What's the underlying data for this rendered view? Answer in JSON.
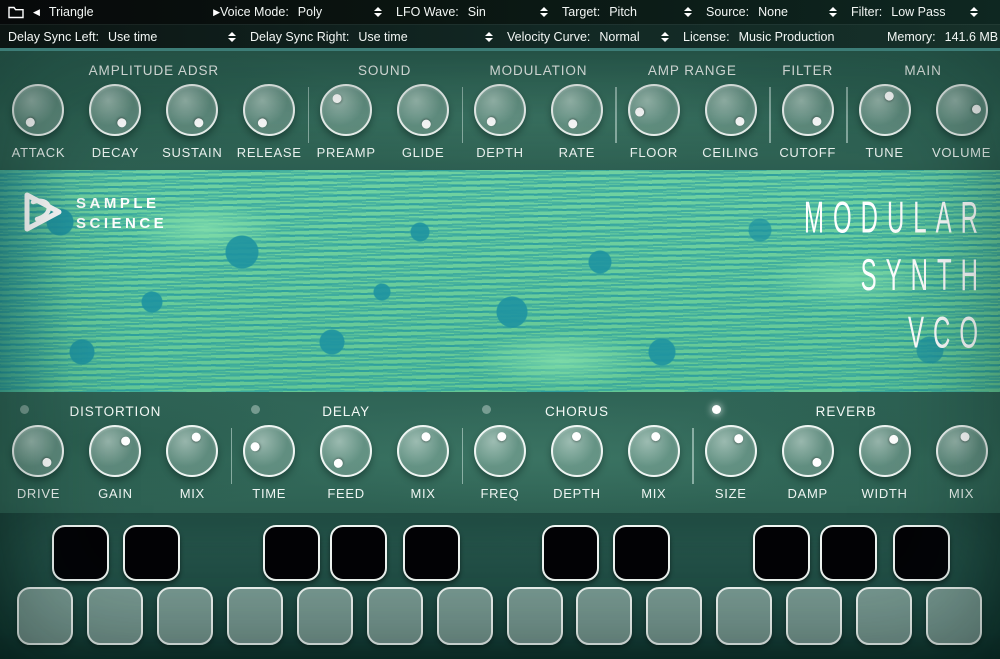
{
  "menu_bar": {
    "preset": {
      "name": "Triangle"
    },
    "row1_items": [
      {
        "label": "Voice Mode:",
        "value": "Poly",
        "stepper": true
      },
      {
        "label": "LFO Wave:",
        "value": "Sin",
        "stepper": true
      },
      {
        "label": "Target:",
        "value": "Pitch",
        "stepper": true
      },
      {
        "label": "Source:",
        "value": "None",
        "stepper": true
      },
      {
        "label": "Filter:",
        "value": "Low Pass",
        "stepper": true
      }
    ],
    "row2_items": [
      {
        "label": "Delay Sync Left:",
        "value": "Use time",
        "stepper": true
      },
      {
        "label": "Delay Sync Right:",
        "value": "Use time",
        "stepper": true
      },
      {
        "label": "Velocity Curve:",
        "value": "Normal",
        "stepper": true
      },
      {
        "label": "License:",
        "value": "Music Production",
        "stepper": false
      },
      {
        "label": "Memory:",
        "value": "141.6 MB",
        "stepper": false
      }
    ]
  },
  "branding": {
    "logo_word1": "SAMPLE",
    "logo_word2": "SCIENCE",
    "title_lines": [
      "MODULAR",
      "SYNTH",
      "VCO"
    ]
  },
  "top_sections": [
    {
      "title": "AMPLITUDE ADSR",
      "knobs": [
        {
          "label": "ATTACK",
          "angle": 210
        },
        {
          "label": "DECAY",
          "angle": 150
        },
        {
          "label": "SUSTAIN",
          "angle": 150
        },
        {
          "label": "RELEASE",
          "angle": 205
        }
      ]
    },
    {
      "title": "SOUND",
      "knobs": [
        {
          "label": "PREAMP",
          "angle": 320
        },
        {
          "label": "GLIDE",
          "angle": 165
        }
      ]
    },
    {
      "title": "MODULATION",
      "knobs": [
        {
          "label": "DEPTH",
          "angle": 215
        },
        {
          "label": "RATE",
          "angle": 195
        }
      ]
    },
    {
      "title": "AMP RANGE",
      "knobs": [
        {
          "label": "FLOOR",
          "angle": 260
        },
        {
          "label": "CEILING",
          "angle": 140
        }
      ]
    },
    {
      "title": "FILTER",
      "knobs": [
        {
          "label": "CUTOFF",
          "angle": 140
        }
      ]
    },
    {
      "title": "MAIN",
      "knobs": [
        {
          "label": "TUNE",
          "angle": 15
        },
        {
          "label": "VOLUME",
          "angle": 85
        }
      ]
    }
  ],
  "effect_sections": [
    {
      "title": "DISTORTION",
      "led": "off",
      "knobs": [
        {
          "label": "DRIVE",
          "angle": 140
        },
        {
          "label": "GAIN",
          "angle": 45
        },
        {
          "label": "MIX",
          "angle": 15
        }
      ]
    },
    {
      "title": "DELAY",
      "led": "off",
      "knobs": [
        {
          "label": "TIME",
          "angle": 285
        },
        {
          "label": "FEED",
          "angle": 210
        },
        {
          "label": "MIX",
          "angle": 10
        }
      ]
    },
    {
      "title": "CHORUS",
      "led": "off",
      "knobs": [
        {
          "label": "FREQ",
          "angle": 5
        },
        {
          "label": "DEPTH",
          "angle": 0
        },
        {
          "label": "MIX",
          "angle": 5
        }
      ]
    },
    {
      "title": "REVERB",
      "led": "on",
      "knobs": [
        {
          "label": "SIZE",
          "angle": 30
        },
        {
          "label": "DAMP",
          "angle": 140
        },
        {
          "label": "WIDTH",
          "angle": 35
        },
        {
          "label": "MIX",
          "angle": 10
        }
      ]
    }
  ],
  "keyboard": {
    "white_keys": 14,
    "black_keys": 10
  },
  "colors": {
    "art_base": "#67cb9b",
    "art_pattern": "#1e93a0",
    "panel_green": "#2f6355",
    "knob_border": "#eff6f3",
    "led_on": "#ffffff"
  }
}
